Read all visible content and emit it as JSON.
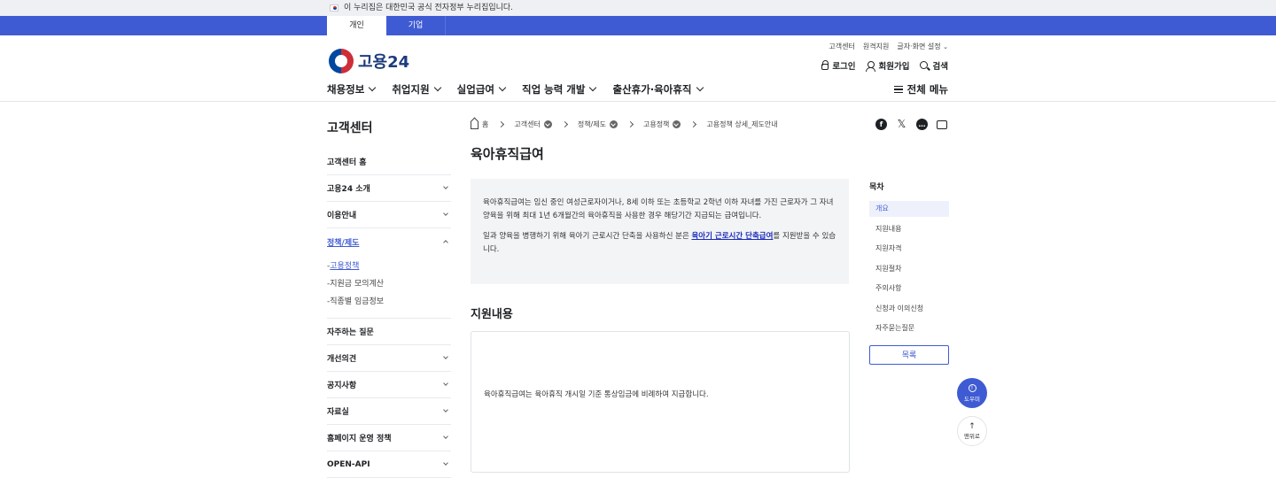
{
  "gov_banner": {
    "text": "이 누리집은 대한민국 공식 전자정부 누리집입니다."
  },
  "audience_tabs": [
    {
      "label": "개인"
    },
    {
      "label": "기업"
    }
  ],
  "util_links": {
    "customer_center": "고객센터",
    "remote_support": "원격지원",
    "display_settings": "글자·화면 설정"
  },
  "logo": {
    "text": "고용24"
  },
  "user_links": {
    "login": "로그인",
    "signup": "회원가입",
    "search": "검색"
  },
  "gnb": [
    {
      "label": "채용정보"
    },
    {
      "label": "취업지원"
    },
    {
      "label": "실업급여"
    },
    {
      "label": "직업 능력 개발"
    },
    {
      "label": "출산휴가·육아휴직"
    }
  ],
  "all_menu": "전체 메뉴",
  "sidebar": {
    "title": "고객센터",
    "items": [
      {
        "label": "고객센터 홈"
      },
      {
        "label": "고용24 소개"
      },
      {
        "label": "이용안내"
      },
      {
        "label": "정책/제도"
      },
      {
        "label": "자주하는 질문"
      },
      {
        "label": "개선의견"
      },
      {
        "label": "공지사항"
      },
      {
        "label": "자료실"
      },
      {
        "label": "홈페이지 운영 정책"
      },
      {
        "label": "OPEN-API"
      }
    ],
    "sub_items": [
      {
        "label": "고용정책"
      },
      {
        "label": "지원금 모의계산"
      },
      {
        "label": "직종별 임금정보"
      }
    ]
  },
  "breadcrumb": [
    "홈",
    "고객센터",
    "정책/제도",
    "고용정책",
    "고용정책 상세_제도안내"
  ],
  "share": {
    "facebook": "f",
    "x": "𝕏",
    "talk": "…"
  },
  "page_title": "육아휴직급여",
  "summary": {
    "p1": "육아휴직급여는 임신 중인 여성근로자이거나, 8세 이하 또는 초등학교 2학년 이하 자녀를 가진 근로자가 그 자녀 양육을 위해 최대 1년 6개월간의 육아휴직을 사용한 경우 해당기간 지급되는 급여입니다.",
    "p2_before": "일과 양육을 병행하기 위해 육아기 근로시간 단축을 사용하신 분은 ",
    "p2_link": "육아기 근로시간 단축급여",
    "p2_after": "를 지원받을 수 있습니다."
  },
  "section": {
    "title": "지원내용",
    "text": "육아휴직급여는 육아휴직 개시일 기준 통상임금에 비례하여 지급합니다."
  },
  "toc": {
    "title": "목차",
    "items": [
      "개요",
      "지원내용",
      "지원자격",
      "지원절차",
      "주의사항",
      "신청과 이의신청",
      "자주묻는질문"
    ],
    "list_button": "목록"
  },
  "fab": {
    "help": "도우미",
    "top": "맨위로"
  },
  "colors": {
    "accent": "#3f5bd3",
    "link": "#1a2bb8"
  }
}
